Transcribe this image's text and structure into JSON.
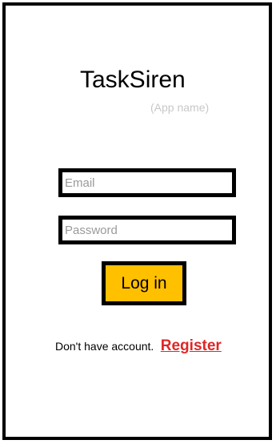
{
  "app": {
    "title": "TaskSiren",
    "subtitle": "(App name)"
  },
  "form": {
    "email_placeholder": "Email",
    "email_value": "",
    "password_placeholder": "Password",
    "password_value": "",
    "login_label": "Log in"
  },
  "register": {
    "prompt": "Don't have account.",
    "link_label": "Register"
  },
  "colors": {
    "accent": "#ffc000",
    "link": "#e02626",
    "border": "#000000",
    "background": "#ffffff",
    "subtitle": "#c8c8c8"
  }
}
